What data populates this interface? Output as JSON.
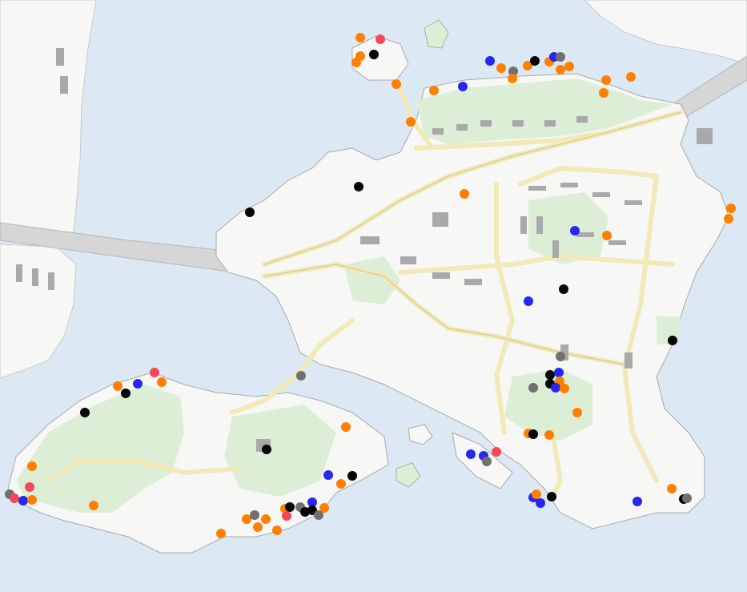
{
  "map": {
    "colors": {
      "water": "#dce9f5",
      "land": "#f7f7f5",
      "park": "#dcefd6",
      "road": "#f1e9b8",
      "road_edge": "#cfc48a",
      "building": "#a9a9a9",
      "motorway": "#d6d6d6"
    },
    "marker_colors": {
      "orange": "#ff8000",
      "red": "#f5475a",
      "blue": "#2727ee",
      "black": "#050505",
      "gray": "#707070"
    }
  }
}
